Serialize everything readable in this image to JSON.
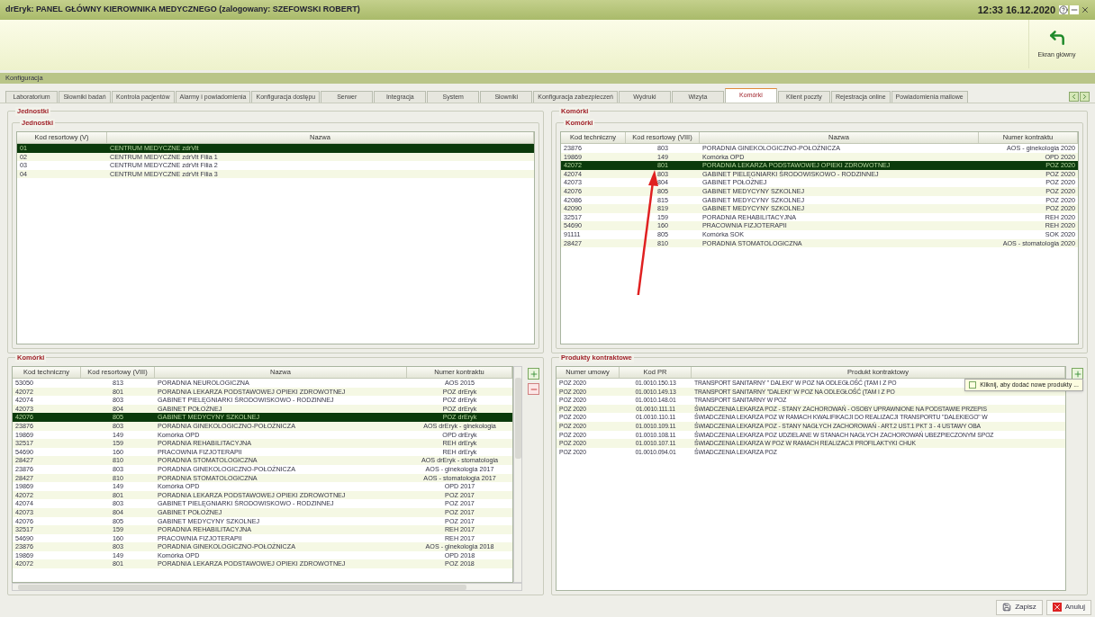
{
  "window": {
    "title": "drEryk: PANEL GŁÓWNY KIEROWNIKA MEDYCZNEGO (zalogowany: SZEFOWSKI ROBERT)",
    "clock": "12:33 16.12.2020"
  },
  "toolbar": {
    "home_button": "Ekran główny"
  },
  "section_bar": "Konfiguracja",
  "tabs": [
    {
      "label": "Laboratorium",
      "selected": false
    },
    {
      "label": "Słowniki badań",
      "selected": false
    },
    {
      "label": "Kontrola pacjentów",
      "selected": false
    },
    {
      "label": "Alarmy i powiadomienia",
      "selected": false
    },
    {
      "label": "Konfiguracja dostępu",
      "selected": false
    },
    {
      "label": "Serwer",
      "selected": false
    },
    {
      "label": "Integracja",
      "selected": false
    },
    {
      "label": "System",
      "selected": false
    },
    {
      "label": "Słowniki",
      "selected": false
    },
    {
      "label": "Konfiguracja zabezpieczeń",
      "selected": false
    },
    {
      "label": "Wydruki",
      "selected": false
    },
    {
      "label": "Wizyta",
      "selected": false
    },
    {
      "label": "Komórki",
      "selected": true
    },
    {
      "label": "Klient poczty",
      "selected": false
    },
    {
      "label": "Rejestracja online",
      "selected": false
    },
    {
      "label": "Powiadomienia mailowe",
      "selected": false
    }
  ],
  "units_panel": {
    "title": "Jednostki",
    "group": "Jednostki",
    "columns": [
      "Kod resortowy (V)",
      "Nazwa"
    ],
    "rows": [
      {
        "cells": [
          "01",
          "CENTRUM MEDYCZNE zdrVit"
        ],
        "selected": true
      },
      {
        "cells": [
          "02",
          "CENTRUM MEDYCZNE zdrVit Filia 1"
        ],
        "selected": false
      },
      {
        "cells": [
          "03",
          "CENTRUM MEDYCZNE zdrVit Filia 2"
        ],
        "selected": false
      },
      {
        "cells": [
          "04",
          "CENTRUM MEDYCZNE zdrVit Filia 3"
        ],
        "selected": false
      }
    ]
  },
  "cells_panel": {
    "title": "Komórki",
    "group": "Komórki",
    "columns": [
      "Kod techniczny",
      "Kod resortowy (VIII)",
      "Nazwa",
      "Numer kontraktu"
    ],
    "rows": [
      {
        "cells": [
          "23876",
          "803",
          "PORADNIA GINEKOLOGICZNO-POŁOŻNICZA",
          "AOS - ginekologia 2020"
        ],
        "selected": false
      },
      {
        "cells": [
          "19869",
          "149",
          "Komórka OPD",
          "OPD 2020"
        ],
        "selected": false
      },
      {
        "cells": [
          "42072",
          "801",
          "PORADNIA LEKARZA PODSTAWOWEJ OPIEKI ZDROWOTNEJ",
          "POZ 2020"
        ],
        "selected": true
      },
      {
        "cells": [
          "42074",
          "803",
          "GABINET PIELĘGNIARKI ŚRODOWISKOWO - RODZINNEJ",
          "POZ 2020"
        ],
        "selected": false
      },
      {
        "cells": [
          "42073",
          "804",
          "GABINET POŁOŻNEJ",
          "POZ 2020"
        ],
        "selected": false
      },
      {
        "cells": [
          "42076",
          "805",
          "GABINET MEDYCYNY SZKOLNEJ",
          "POZ 2020"
        ],
        "selected": false
      },
      {
        "cells": [
          "42086",
          "815",
          "GABINET MEDYCYNY SZKOLNEJ",
          "POZ 2020"
        ],
        "selected": false
      },
      {
        "cells": [
          "42090",
          "819",
          "GABINET MEDYCYNY SZKOLNEJ",
          "POZ 2020"
        ],
        "selected": false
      },
      {
        "cells": [
          "32517",
          "159",
          "PORADNIA REHABILITACYJNA",
          "REH 2020"
        ],
        "selected": false
      },
      {
        "cells": [
          "54690",
          "160",
          "PRACOWNIA FIZJOTERAPII",
          "REH 2020"
        ],
        "selected": false
      },
      {
        "cells": [
          "91111",
          "805",
          "Komórka SOK",
          "SOK 2020"
        ],
        "selected": false
      },
      {
        "cells": [
          "28427",
          "810",
          "PORADNIA STOMATOLOGICZNA",
          "AOS - stomatologia 2020"
        ],
        "selected": false
      }
    ]
  },
  "all_cells": {
    "group": "Komórki",
    "columns": [
      "Kod techniczny",
      "Kod resortowy (VIII)",
      "Nazwa",
      "Numer kontraktu"
    ],
    "rows": [
      {
        "cells": [
          "53050",
          "813",
          "PORADNIA NEUROLOGICZNA",
          "AOS 2015"
        ],
        "selected": false
      },
      {
        "cells": [
          "42072",
          "801",
          "PORADNIA LEKARZA PODSTAWOWEJ OPIEKI ZDROWOTNEJ",
          "POZ drEryk"
        ],
        "selected": false
      },
      {
        "cells": [
          "42074",
          "803",
          "GABINET PIELĘGNIARKI ŚRODOWISKOWO - RODZINNEJ",
          "POZ drEryk"
        ],
        "selected": false
      },
      {
        "cells": [
          "42073",
          "804",
          "GABINET POŁOŻNEJ",
          "POZ drEryk"
        ],
        "selected": false
      },
      {
        "cells": [
          "42076",
          "805",
          "GABINET MEDYCYNY SZKOLNEJ",
          "POZ drEryk"
        ],
        "selected": true
      },
      {
        "cells": [
          "23876",
          "803",
          "PORADNIA GINEKOLOGICZNO-POŁOŻNICZA",
          "AOS drEryk - ginekologia"
        ],
        "selected": false
      },
      {
        "cells": [
          "19869",
          "149",
          "Komórka OPD",
          "OPD drEryk"
        ],
        "selected": false
      },
      {
        "cells": [
          "32517",
          "159",
          "PORADNIA REHABILITACYJNA",
          "REH drEryk"
        ],
        "selected": false
      },
      {
        "cells": [
          "54690",
          "160",
          "PRACOWNIA FIZJOTERAPII",
          "REH drEryk"
        ],
        "selected": false
      },
      {
        "cells": [
          "28427",
          "810",
          "PORADNIA STOMATOLOGICZNA",
          "AOS drEryk - stomatologia"
        ],
        "selected": false
      },
      {
        "cells": [
          "23876",
          "803",
          "PORADNIA GINEKOLOGICZNO-POŁOŻNICZA",
          "AOS - ginekologia 2017"
        ],
        "selected": false
      },
      {
        "cells": [
          "28427",
          "810",
          "PORADNIA STOMATOLOGICZNA",
          "AOS - stomatologia 2017"
        ],
        "selected": false
      },
      {
        "cells": [
          "19869",
          "149",
          "Komórka OPD",
          "OPD 2017"
        ],
        "selected": false
      },
      {
        "cells": [
          "42072",
          "801",
          "PORADNIA LEKARZA PODSTAWOWEJ OPIEKI ZDROWOTNEJ",
          "POZ 2017"
        ],
        "selected": false
      },
      {
        "cells": [
          "42074",
          "803",
          "GABINET PIELĘGNIARKI ŚRODOWISKOWO - RODZINNEJ",
          "POZ 2017"
        ],
        "selected": false
      },
      {
        "cells": [
          "42073",
          "804",
          "GABINET POŁOŻNEJ",
          "POZ 2017"
        ],
        "selected": false
      },
      {
        "cells": [
          "42076",
          "805",
          "GABINET MEDYCYNY SZKOLNEJ",
          "POZ 2017"
        ],
        "selected": false
      },
      {
        "cells": [
          "32517",
          "159",
          "PORADNIA REHABILITACYJNA",
          "REH 2017"
        ],
        "selected": false
      },
      {
        "cells": [
          "54690",
          "160",
          "PRACOWNIA FIZJOTERAPII",
          "REH 2017"
        ],
        "selected": false
      },
      {
        "cells": [
          "23876",
          "803",
          "PORADNIA GINEKOLOGICZNO-POŁOŻNICZA",
          "AOS - ginekologia 2018"
        ],
        "selected": false
      },
      {
        "cells": [
          "19869",
          "149",
          "Komórka OPD",
          "OPD 2018"
        ],
        "selected": false
      },
      {
        "cells": [
          "42072",
          "801",
          "PORADNIA LEKARZA PODSTAWOWEJ OPIEKI ZDROWOTNEJ",
          "POZ 2018"
        ],
        "selected": false
      }
    ]
  },
  "products": {
    "group": "Produkty kontraktowe",
    "columns": [
      "Numer umowy",
      "Kod PR",
      "Produkt kontraktowy"
    ],
    "tooltip": "Kliknij, aby dodać nowe produkty ...",
    "rows": [
      {
        "cells": [
          "POZ 2020",
          "01.0010.150.13",
          "TRANSPORT SANITARNY \" DALEKI\" W POZ NA ODLEGŁOŚĆ (TAM I Z PO"
        ],
        "selected": false
      },
      {
        "cells": [
          "POZ 2020",
          "01.0010.149.13",
          "TRANSPORT SANITARNY \"DALEKI\" W POZ NA ODLEGŁOŚĆ (TAM I Z PO"
        ],
        "selected": false
      },
      {
        "cells": [
          "POZ 2020",
          "01.0010.148.01",
          "TRANSPORT SANITARNY W POZ"
        ],
        "selected": false
      },
      {
        "cells": [
          "POZ 2020",
          "01.0010.111.11",
          "ŚWIADCZENIA LEKARZA POZ - STANY ZACHOROWAŃ - OSOBY UPRAWNIONE NA PODSTAWIE PRZEPIS"
        ],
        "selected": false
      },
      {
        "cells": [
          "POZ 2020",
          "01.0010.110.11",
          "ŚWIADCZENIA LEKARZA POZ W RAMACH KWALIFIKACJI DO REALIZACJI TRANSPORTU \"DALEKIEGO\" W"
        ],
        "selected": false
      },
      {
        "cells": [
          "POZ 2020",
          "01.0010.109.11",
          "ŚWIADCZENIA LEKARZA POZ - STANY NAGŁYCH ZACHOROWAŃ - ART.2 UST.1 PKT 3 - 4 USTAWY OBA"
        ],
        "selected": false
      },
      {
        "cells": [
          "POZ 2020",
          "01.0010.108.11",
          "ŚWIADCZENIA LEKARZA POZ UDZIELANE W STANACH NAGŁYCH ZACHOROWAŃ UBEZPIECZONYM SPOZ"
        ],
        "selected": false
      },
      {
        "cells": [
          "POZ 2020",
          "01.0010.107.11",
          "ŚWIADCZENIA LEKARZA W POZ W RAMACH REALIZACJI PROFILAKTYKI CHUK"
        ],
        "selected": false
      },
      {
        "cells": [
          "POZ 2020",
          "01.0010.094.01",
          "ŚWIADCZENIA LEKARZA POZ"
        ],
        "selected": false
      }
    ]
  },
  "footer": {
    "save": "Zapisz",
    "cancel": "Anuluj"
  }
}
